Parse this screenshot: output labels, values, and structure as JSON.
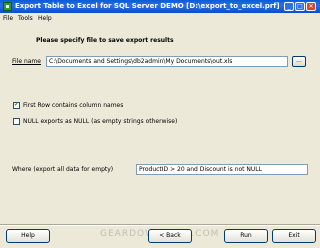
{
  "window": {
    "title": "Export Table to Excel for SQL Server DEMO [D:\\export_to_excel.prf]"
  },
  "titlebar_buttons": [
    "_",
    "□",
    "✕"
  ],
  "menu": [
    "File",
    "Tools",
    "Help"
  ],
  "heading": "Please specify file to save export results",
  "file": {
    "label": "File name",
    "value": "C:\\Documents and Settings\\db2admin\\My Documents\\out.xls",
    "browse": "..."
  },
  "options": [
    {
      "label": "First Row contains column names",
      "checked": true
    },
    {
      "label": "NULL exports as NULL (as empty strings otherwise)",
      "checked": false
    }
  ],
  "where": {
    "label": "Where (export all data for empty)",
    "value": "ProductID > 20 and Discount is not NULL"
  },
  "buttons": {
    "help": "Help",
    "back": "< Back",
    "run": "Run",
    "exit": "Exit"
  },
  "watermark": "GEARDOWNLOAD.COM"
}
